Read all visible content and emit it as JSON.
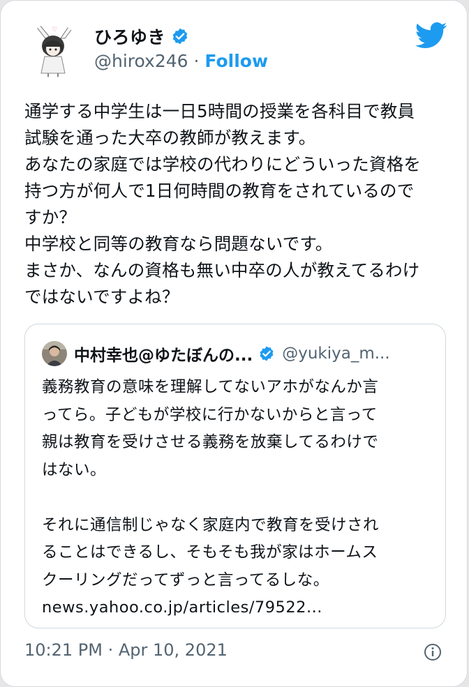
{
  "tweet": {
    "author_name": "ひろゆき",
    "handle": "@hirox246",
    "separator": " · ",
    "follow_label": "Follow",
    "text": "通学する中学生は一日5時間の授業を各科目で教員\n試験を通った大卒の教師が教えます。\nあなたの家庭では学校の代わりにどういった資格を\n持つ方が何人で1日何時間の教育をされているので\nすか？\n中学校と同等の教育なら問題ないです。\nまさか、なんの資格も無い中卒の人が教えてるわけ\nではないですよね？",
    "timestamp": "10:21 PM · Apr 10, 2021"
  },
  "quoted": {
    "author_name": "中村幸也@ゆたぼんの...",
    "handle": "@yukiya_m...",
    "text": "義務教育の意味を理解してないアホがなんか言\nってら。子どもが学校に行かないからと言って\n親は教育を受けさせる義務を放棄してるわけで\nはない。\n\nそれに通信制じゃなく家庭内で教育を受けされ\nることはできるし、そもそも我が家はホームス\nクーリングだってずっと言ってるしな。\nnews.yahoo.co.jp/articles/79522..."
  },
  "icons": {
    "twitter": "twitter-bird-icon",
    "verified": "verified-badge-icon",
    "info": "info-icon"
  },
  "colors": {
    "accent": "#1d9bf0",
    "text": "#0f1419",
    "secondary": "#536471",
    "border": "#cfd9de"
  }
}
